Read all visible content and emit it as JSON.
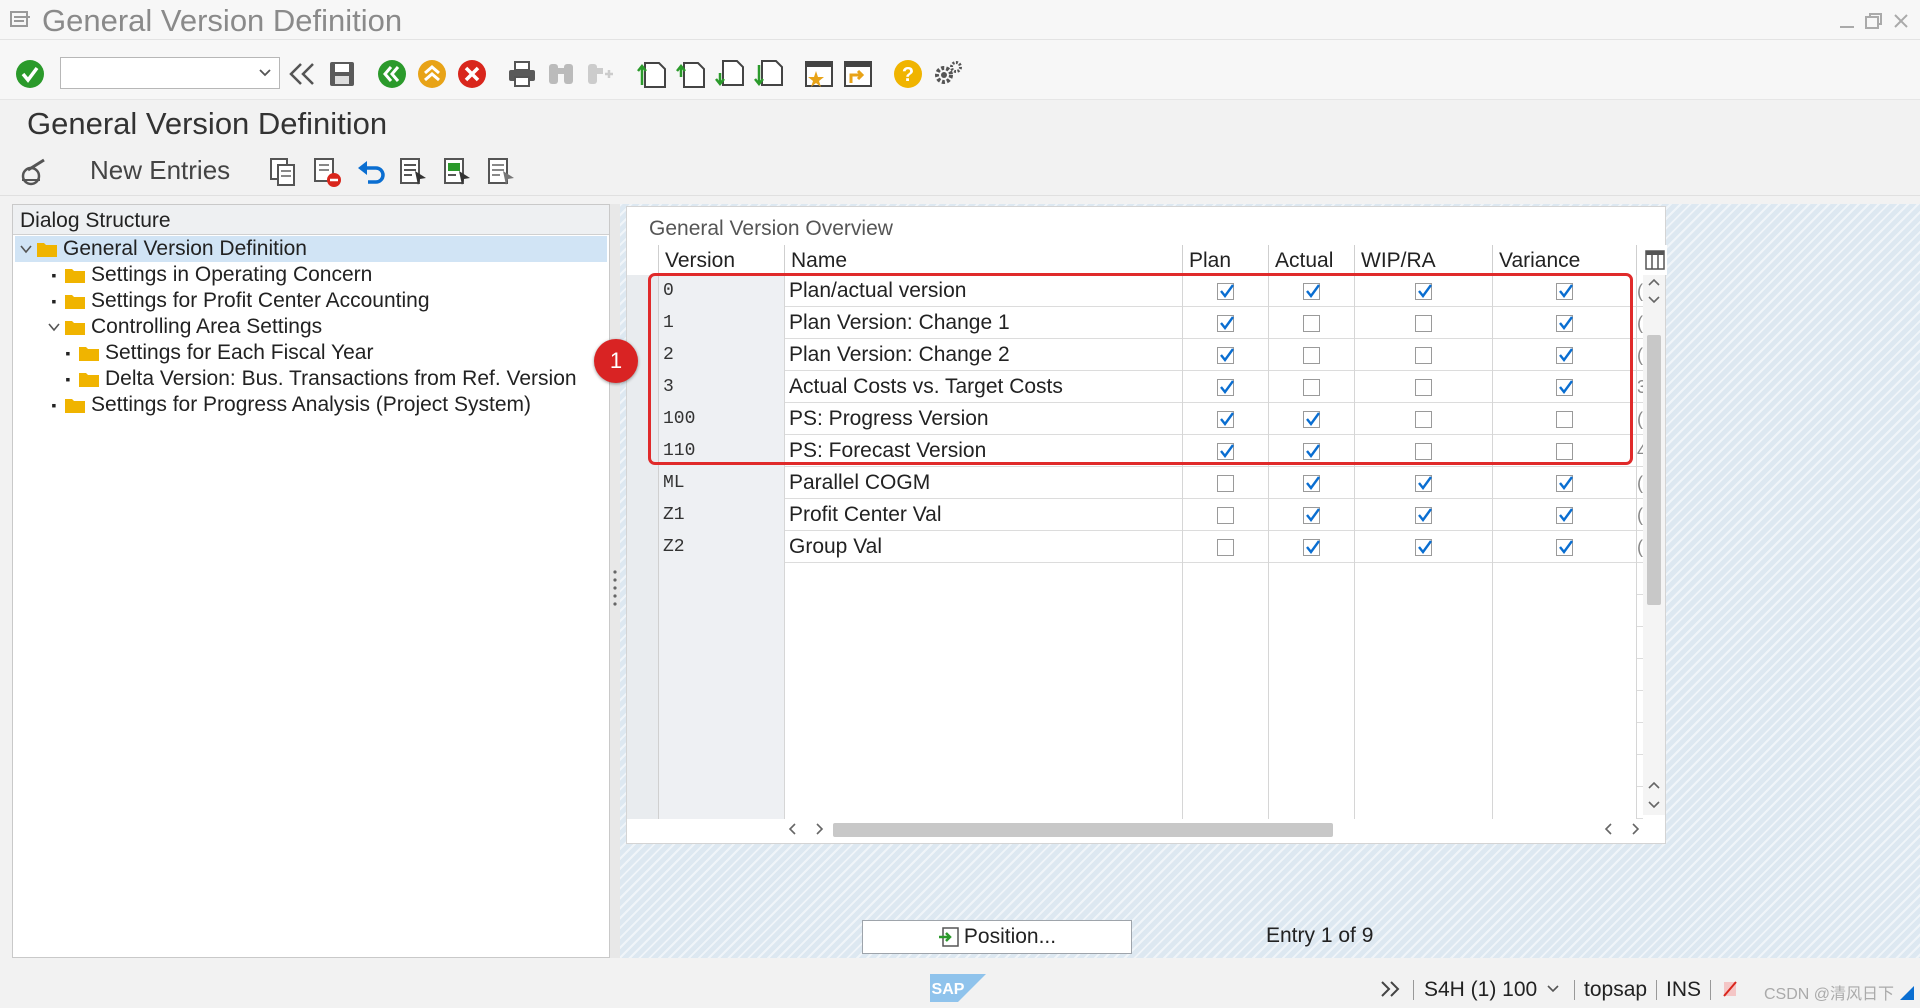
{
  "window": {
    "title": "General Version Definition"
  },
  "toolbar": {
    "command_value": "",
    "icons": [
      "enter-icon",
      "command-field",
      "back-double-icon",
      "save-icon",
      "back-icon",
      "exit-icon",
      "cancel-icon",
      "print-icon",
      "find-icon",
      "find-next-icon",
      "first-page-icon",
      "previous-page-icon",
      "next-page-icon",
      "last-page-icon",
      "create-session-icon",
      "shortcut-icon",
      "help-icon",
      "customize-icon"
    ]
  },
  "page": {
    "title": "General Version Definition"
  },
  "appbar": {
    "new_entries": "New Entries"
  },
  "tree": {
    "header": "Dialog Structure",
    "nodes": [
      {
        "label": "General Version Definition",
        "level": 0,
        "expanded": true,
        "selected": true
      },
      {
        "label": "Settings in Operating Concern",
        "level": 1
      },
      {
        "label": "Settings for Profit Center Accounting",
        "level": 1
      },
      {
        "label": "Controlling Area Settings",
        "level": 1,
        "expanded": true
      },
      {
        "label": "Settings for Each Fiscal Year",
        "level": 2
      },
      {
        "label": "Delta Version: Bus. Transactions from Ref. Version",
        "level": 2
      },
      {
        "label": "Settings for Progress Analysis (Project System)",
        "level": 1
      }
    ]
  },
  "overview": {
    "title": "General Version Overview",
    "columns": [
      "Version",
      "Name",
      "Plan",
      "Actual",
      "WIP/RA",
      "Variance"
    ],
    "rows": [
      {
        "version": "0",
        "name": "Plan/actual version",
        "plan": true,
        "actual": true,
        "wip": true,
        "variance": true,
        "more": "("
      },
      {
        "version": "1",
        "name": "Plan Version: Change 1",
        "plan": true,
        "actual": false,
        "wip": false,
        "variance": true,
        "more": "("
      },
      {
        "version": "2",
        "name": "Plan Version: Change 2",
        "plan": true,
        "actual": false,
        "wip": false,
        "variance": true,
        "more": "("
      },
      {
        "version": "3",
        "name": "Actual Costs vs. Target Costs",
        "plan": true,
        "actual": false,
        "wip": false,
        "variance": true,
        "more": "3"
      },
      {
        "version": "100",
        "name": "PS: Progress Version",
        "plan": true,
        "actual": true,
        "wip": false,
        "variance": false,
        "more": "("
      },
      {
        "version": "110",
        "name": "PS: Forecast Version",
        "plan": true,
        "actual": true,
        "wip": false,
        "variance": false,
        "more": "4"
      },
      {
        "version": "ML",
        "name": "Parallel COGM",
        "plan": false,
        "actual": true,
        "wip": true,
        "variance": true,
        "more": "("
      },
      {
        "version": "Z1",
        "name": "Profit Center Val",
        "plan": false,
        "actual": true,
        "wip": true,
        "variance": true,
        "more": "("
      },
      {
        "version": "Z2",
        "name": "Group Val",
        "plan": false,
        "actual": true,
        "wip": true,
        "variance": true,
        "more": "("
      }
    ],
    "empty_rows": 8
  },
  "annotation": {
    "badge": "1",
    "color": "#e02a2a"
  },
  "footer": {
    "position_label": "Position...",
    "entry_info": "Entry 1 of 9"
  },
  "statusbar": {
    "system": "S4H (1) 100",
    "server": "topsap",
    "mode": "INS",
    "watermark": "CSDN @清风日下"
  },
  "colors": {
    "accent": "#0a6ed1",
    "green": "#2b9a2b",
    "orange": "#e8a317",
    "red": "#d9261c",
    "folder": "#f0b400"
  }
}
